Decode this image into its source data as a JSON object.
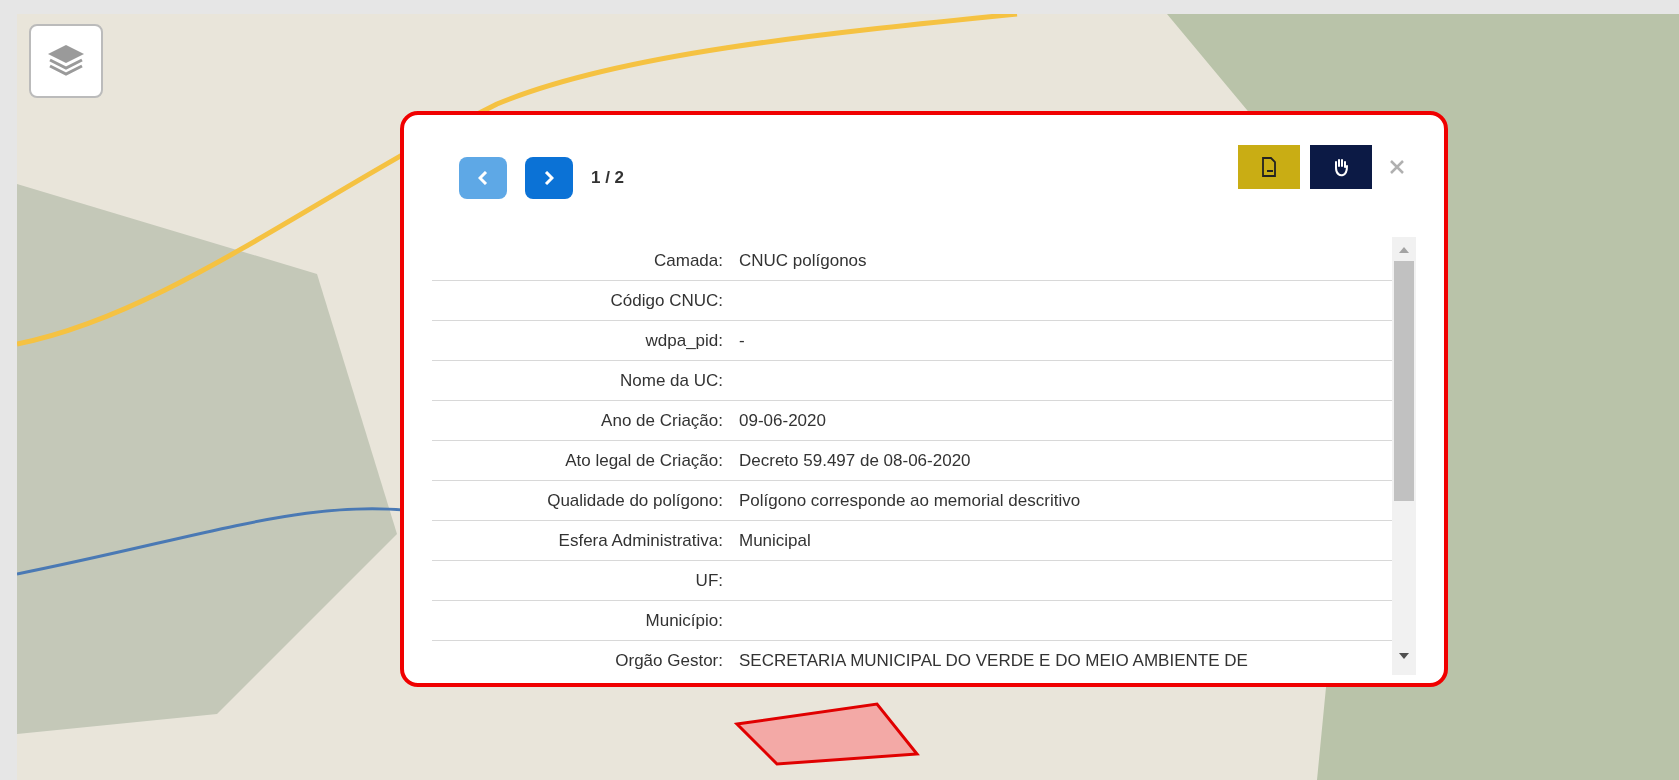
{
  "popup": {
    "pager": {
      "prev": {
        "disabled": true
      },
      "next": {
        "disabled": false
      },
      "label": "1 / 2"
    },
    "rows": [
      {
        "label": "Camada:",
        "value": "CNUC polígonos"
      },
      {
        "label": "Código CNUC:"
      },
      {
        "label": "wdpa_pid:",
        "value": "-"
      },
      {
        "label": "Nome da UC:"
      },
      {
        "label": "Ano de Criação:",
        "value": "09-06-2020"
      },
      {
        "label": "Ato legal de Criação:",
        "value": "Decreto 59.497 de 08-06-2020"
      },
      {
        "label": "Qualidade do polígono:",
        "value": "Polígono corresponde ao memorial descritivo"
      },
      {
        "label": "Esfera Administrativa:",
        "value": "Municipal"
      },
      {
        "label": "UF:"
      },
      {
        "label": "Município:"
      },
      {
        "label": "Orgão Gestor:",
        "value": "SECRETARIA MUNICIPAL DO VERDE E DO MEIO AMBIENTE DE"
      }
    ]
  }
}
